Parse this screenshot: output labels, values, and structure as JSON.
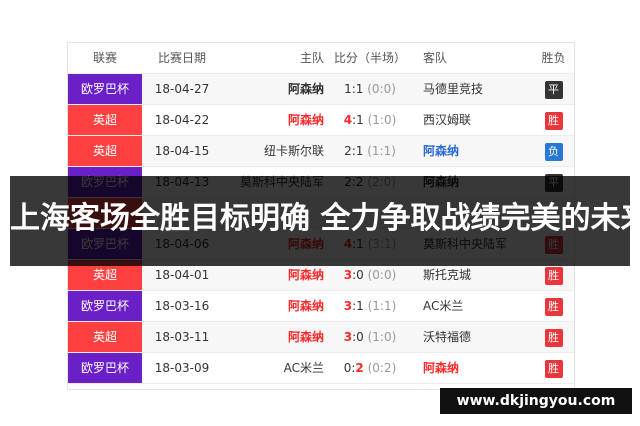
{
  "colors": {
    "europa": "#6b1fc7",
    "premier": "#ff4040",
    "draw": "#333333",
    "win": "#e8363a",
    "loss": "#2a78d6",
    "highlight_red": "#ff2a2a",
    "highlight_blue": "#2a6cd6"
  },
  "headers": {
    "league": "联赛",
    "date": "比赛日期",
    "home": "主队",
    "score": "比分（半场）",
    "away": "客队",
    "result": "胜负"
  },
  "rows": [
    {
      "league": "欧罗巴杯",
      "league_type": "europa",
      "date": "18-04-27",
      "home": "阿森纳",
      "home_style": "strong",
      "score_home": "1",
      "score_away": "1",
      "half": "(0:0)",
      "away": "马德里竞技",
      "away_style": "",
      "result": "平",
      "result_type": "draw",
      "home_score_red": false
    },
    {
      "league": "英超",
      "league_type": "premier",
      "date": "18-04-22",
      "home": "阿森纳",
      "home_style": "red",
      "score_home": "4",
      "score_away": "1",
      "half": "(1:0)",
      "away": "西汉姆联",
      "away_style": "",
      "result": "胜",
      "result_type": "win",
      "home_score_red": true
    },
    {
      "league": "英超",
      "league_type": "premier",
      "date": "18-04-15",
      "home": "纽卡斯尔联",
      "home_style": "",
      "score_home": "2",
      "score_away": "1",
      "half": "(1:1)",
      "away": "阿森纳",
      "away_style": "blue",
      "result": "负",
      "result_type": "loss",
      "home_score_red": false
    },
    {
      "league": "欧罗巴杯",
      "league_type": "europa",
      "date": "18-04-13",
      "home": "莫斯科中央陆军",
      "home_style": "",
      "score_home": "2",
      "score_away": "2",
      "half": "(2:0)",
      "away": "阿森纳",
      "away_style": "strong",
      "result": "平",
      "result_type": "draw",
      "home_score_red": false
    },
    {
      "league": "",
      "league_type": "premier",
      "date": "",
      "home": "",
      "home_style": "",
      "score_home": "",
      "score_away": "",
      "half": "",
      "away": "",
      "away_style": "",
      "result": "",
      "result_type": "win",
      "home_score_red": false
    },
    {
      "league": "欧罗巴杯",
      "league_type": "europa",
      "date": "18-04-06",
      "home": "阿森纳",
      "home_style": "red",
      "score_home": "4",
      "score_away": "1",
      "half": "(3:1)",
      "away": "莫斯科中央陆军",
      "away_style": "",
      "result": "胜",
      "result_type": "win",
      "home_score_red": true
    },
    {
      "league": "英超",
      "league_type": "premier",
      "date": "18-04-01",
      "home": "阿森纳",
      "home_style": "red",
      "score_home": "3",
      "score_away": "0",
      "half": "(0:0)",
      "away": "斯托克城",
      "away_style": "",
      "result": "胜",
      "result_type": "win",
      "home_score_red": true
    },
    {
      "league": "欧罗巴杯",
      "league_type": "europa",
      "date": "18-03-16",
      "home": "阿森纳",
      "home_style": "red",
      "score_home": "3",
      "score_away": "1",
      "half": "(1:1)",
      "away": "AC米兰",
      "away_style": "",
      "result": "胜",
      "result_type": "win",
      "home_score_red": true
    },
    {
      "league": "英超",
      "league_type": "premier",
      "date": "18-03-11",
      "home": "阿森纳",
      "home_style": "red",
      "score_home": "3",
      "score_away": "0",
      "half": "(1:0)",
      "away": "沃特福德",
      "away_style": "",
      "result": "胜",
      "result_type": "win",
      "home_score_red": true
    },
    {
      "league": "欧罗巴杯",
      "league_type": "europa",
      "date": "18-03-09",
      "home": "AC米兰",
      "home_style": "",
      "score_home": "0",
      "score_away": "2",
      "half": "(0:2)",
      "away": "阿森纳",
      "away_style": "red",
      "result": "胜",
      "result_type": "win",
      "home_score_red": false
    }
  ],
  "banner": {
    "title": "上海客场全胜目标明确 全力争取战绩完美的未来"
  },
  "watermark": {
    "url": "www.dkjingyou.com"
  }
}
